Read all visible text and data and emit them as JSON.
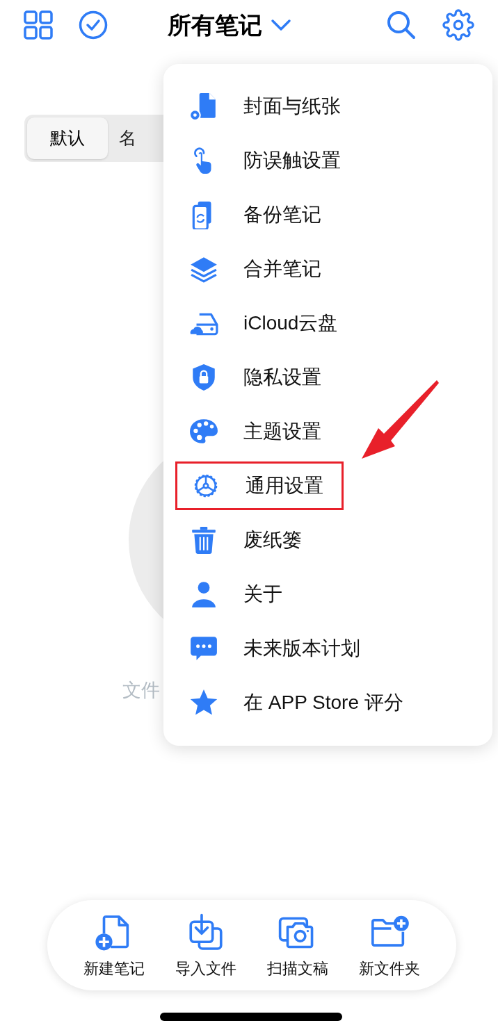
{
  "header": {
    "title": "所有笔记"
  },
  "sort_tabs": [
    {
      "label": "默认",
      "selected": true
    },
    {
      "label": "名",
      "selected": false
    }
  ],
  "empty_text": "文件",
  "settings_menu": {
    "items": [
      {
        "label": "封面与纸张",
        "highlighted": false
      },
      {
        "label": "防误触设置",
        "highlighted": false
      },
      {
        "label": "备份笔记",
        "highlighted": false
      },
      {
        "label": "合并笔记",
        "highlighted": false
      },
      {
        "label": "iCloud云盘",
        "highlighted": false
      },
      {
        "label": "隐私设置",
        "highlighted": false
      },
      {
        "label": "主题设置",
        "highlighted": false
      },
      {
        "label": "通用设置",
        "highlighted": true
      },
      {
        "label": "废纸篓",
        "highlighted": false
      },
      {
        "label": "关于",
        "highlighted": false
      },
      {
        "label": "未来版本计划",
        "highlighted": false
      },
      {
        "label": "在 APP Store 评分",
        "highlighted": false
      }
    ]
  },
  "toolbar": [
    {
      "label": "新建笔记"
    },
    {
      "label": "导入文件"
    },
    {
      "label": "扫描文稿"
    },
    {
      "label": "新文件夹"
    }
  ]
}
